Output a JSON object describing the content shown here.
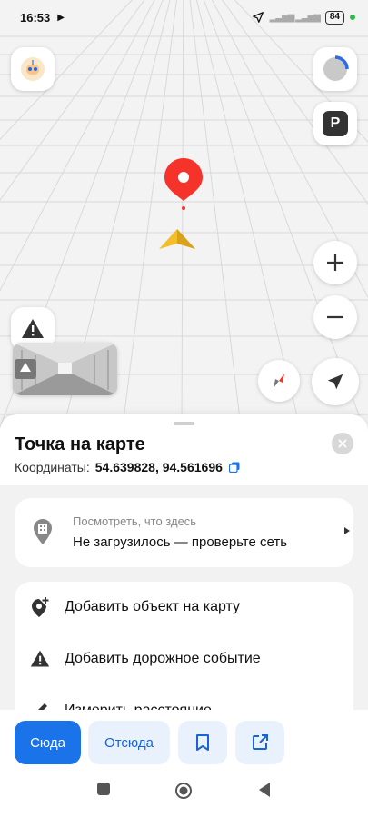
{
  "status_bar": {
    "time": "16:53",
    "battery": "84"
  },
  "map": {
    "accent_pin": "#f5332b",
    "parking_label": "P"
  },
  "sheet": {
    "title": "Точка на карте",
    "coords_label": "Координаты:",
    "coords_value": "54.639828, 94.561696",
    "whats_here": {
      "subtitle": "Посмотреть, что здесь",
      "status": "Не загрузилось — проверьте сеть"
    },
    "actions": [
      {
        "label": "Добавить объект на карту",
        "icon": "add-place-icon"
      },
      {
        "label": "Добавить дорожное событие",
        "icon": "warning-icon"
      },
      {
        "label": "Измерить расстояние",
        "icon": "ruler-icon"
      }
    ]
  },
  "bottom_bar": {
    "to_here": "Сюда",
    "from_here": "Отсюда",
    "bookmark_icon": "bookmark-icon",
    "share_icon": "share-icon"
  },
  "colors": {
    "primary": "#1a73e8",
    "secondary_bg": "#e9f1fd",
    "pin_red": "#f5332b",
    "arrow_gold": "#f2bf2a"
  }
}
